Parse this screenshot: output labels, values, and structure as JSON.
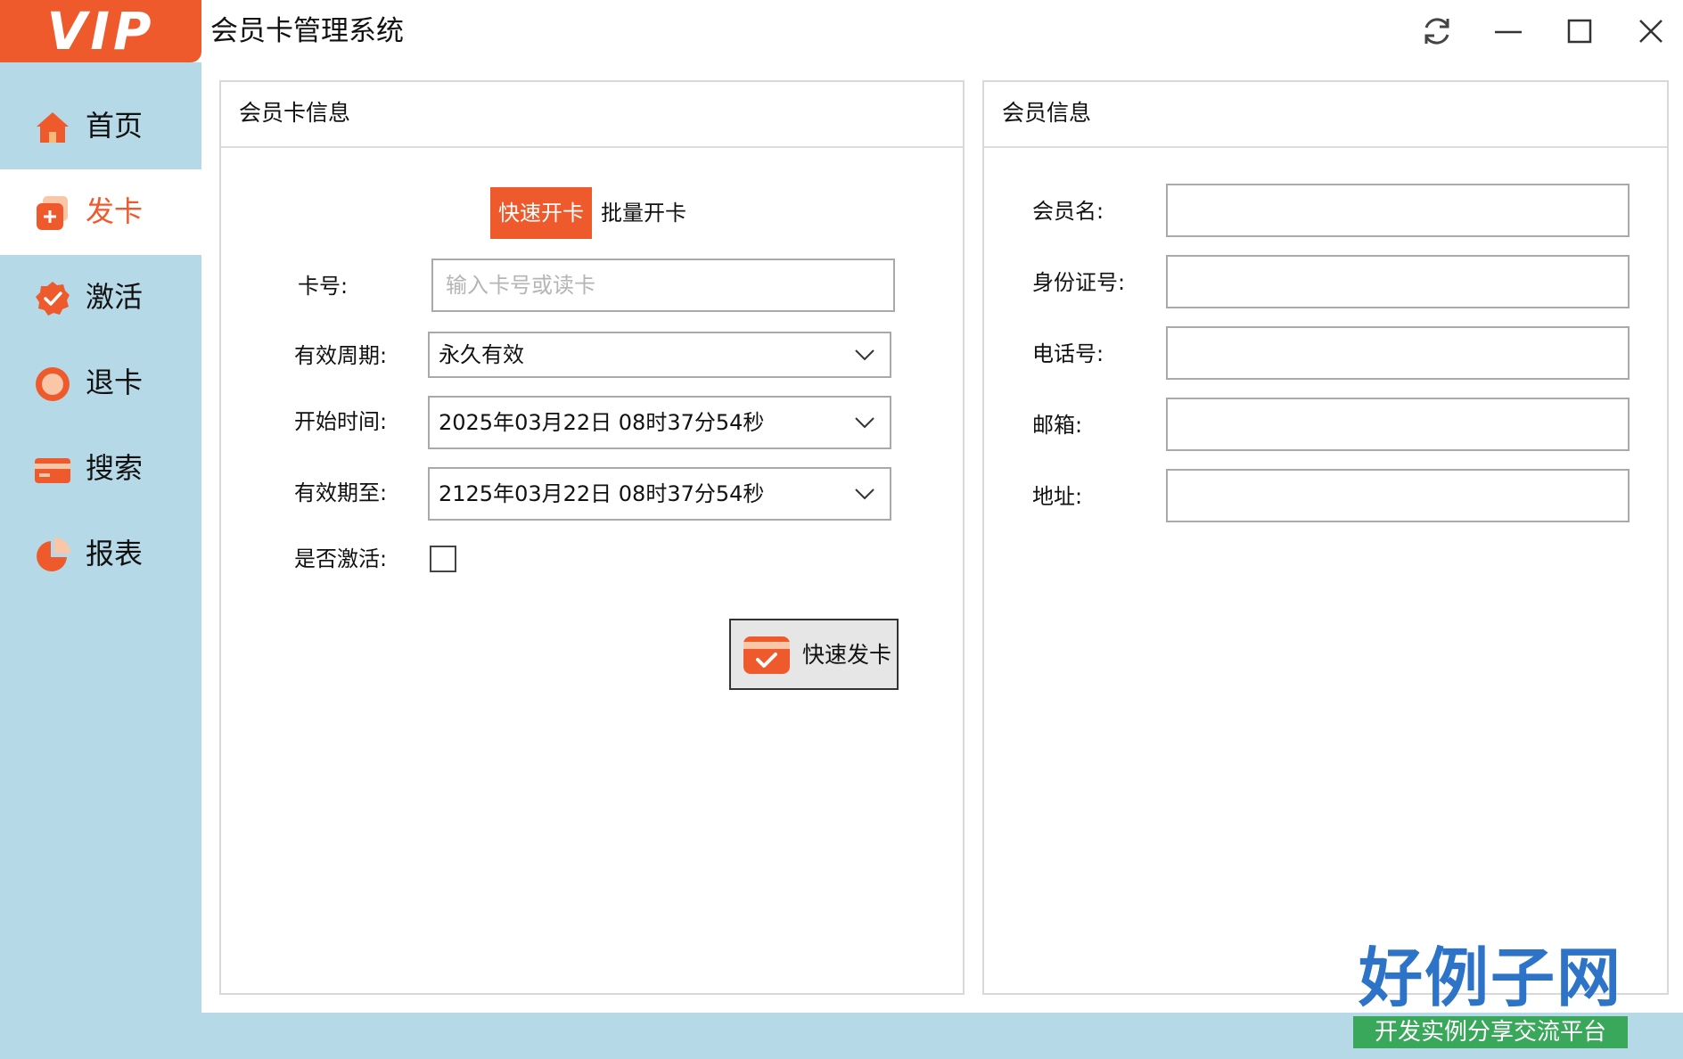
{
  "app": {
    "logo_text": "VIP",
    "title": "会员卡管理系统"
  },
  "window_controls": [
    "refresh-icon",
    "minimize-icon",
    "maximize-icon",
    "close-icon"
  ],
  "sidebar": {
    "items": [
      {
        "label": "首页",
        "icon": "home-icon",
        "active": false
      },
      {
        "label": "发卡",
        "icon": "add-card-icon",
        "active": true
      },
      {
        "label": "激活",
        "icon": "activate-check-icon",
        "active": false
      },
      {
        "label": "退卡",
        "icon": "refund-card-icon",
        "active": false
      },
      {
        "label": "搜索",
        "icon": "search-card-icon",
        "active": false
      },
      {
        "label": "报表",
        "icon": "pie-chart-icon",
        "active": false
      }
    ]
  },
  "card_panel": {
    "title": "会员卡信息",
    "tabs": [
      {
        "label": "快速开卡",
        "active": true
      },
      {
        "label": "批量开卡",
        "active": false
      }
    ],
    "card_no": {
      "label": "卡号:",
      "value": "",
      "placeholder": "输入卡号或读卡"
    },
    "period": {
      "label": "有效周期:",
      "value": "永久有效"
    },
    "start_time": {
      "label": "开始时间:",
      "value": "2025年03月22日 08时37分54秒"
    },
    "expire": {
      "label": "有效期至:",
      "value": "2125年03月22日 08时37分54秒"
    },
    "activate": {
      "label": "是否激活:",
      "checked": false
    },
    "submit_label": "快速发卡"
  },
  "member_panel": {
    "title": "会员信息",
    "fields": [
      {
        "label": "会员名:",
        "value": ""
      },
      {
        "label": "身份证号:",
        "value": ""
      },
      {
        "label": "电话号:",
        "value": ""
      },
      {
        "label": "邮箱:",
        "value": ""
      },
      {
        "label": "地址:",
        "value": ""
      }
    ]
  },
  "watermark": {
    "site_name": "好例子网",
    "slogan": "开发实例分享交流平台"
  },
  "colors": {
    "accent": "#ee5a2c",
    "sidebar_bg": "#b6d9e7",
    "panel_border": "#d8d8d8"
  }
}
